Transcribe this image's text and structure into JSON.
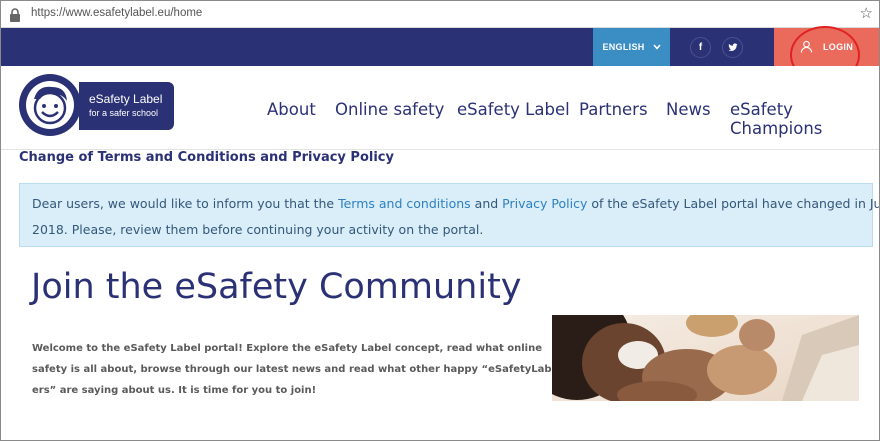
{
  "browser": {
    "url": "https://www.esafetylabel.eu/home",
    "lock_icon": "lock-icon",
    "bookmark_icon": "star-icon"
  },
  "topbar": {
    "language": "ENGLISH",
    "language_icon": "chevron-down-icon",
    "social": [
      {
        "name": "facebook",
        "glyph": "f"
      },
      {
        "name": "twitter",
        "glyph": "🐦"
      }
    ],
    "login_label": "LOGIN",
    "login_icon": "user-icon"
  },
  "logo": {
    "title": "eSafety Label",
    "subtitle": "for a safer school"
  },
  "menu": [
    "About",
    "Online safety",
    "eSafety Label",
    "Partners",
    "News",
    "eSafety Champions"
  ],
  "notice": {
    "title": "Change of Terms and Conditions and Privacy Policy",
    "text_1": "Dear users, we would like to inform you that the ",
    "link_1": "Terms and conditions",
    "text_2": " and ",
    "link_2": "Privacy Policy",
    "text_3": " of the eSafety Label portal have changed in July",
    "line_2": "2018. Please, review them before continuing your activity on the portal."
  },
  "hero": {
    "title": "Join the eSafety Community",
    "welcome_lines": [
      "Welcome to the eSafety Label portal! Explore the eSafety Label concept, read what online",
      "safety is all about, browse through our latest news and read what other happy “eSafetyLabel-",
      "ers” are saying about us. It is time for you to join!"
    ]
  },
  "colors": {
    "brand_navy": "#2b3175",
    "language_blue": "#3b8ec4",
    "login_coral": "#ea6a5b",
    "alert_bg": "#d9eef8",
    "link_blue": "#2f80c2",
    "annotation_red": "#e02222"
  }
}
